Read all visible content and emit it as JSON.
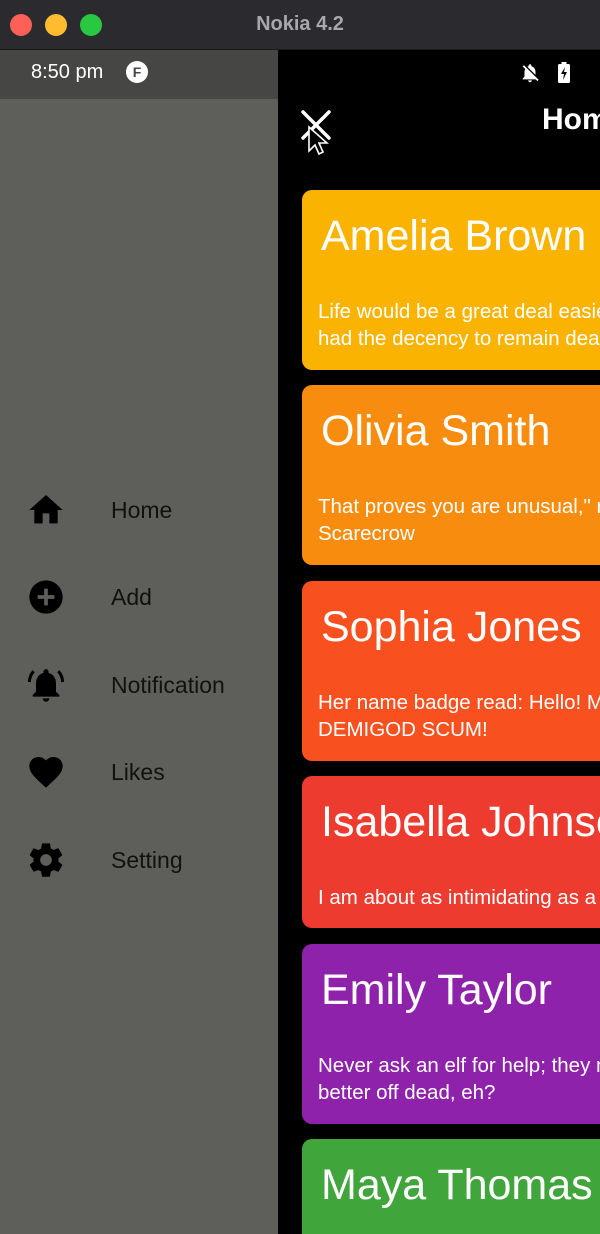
{
  "window": {
    "title": "Nokia 4.2"
  },
  "status_bar": {
    "time": "8:50 pm",
    "app_badge": "F"
  },
  "drawer": {
    "items": [
      {
        "label": "Home",
        "icon": "home-icon"
      },
      {
        "label": "Add",
        "icon": "add-circle-icon"
      },
      {
        "label": "Notification",
        "icon": "bell-ringing-icon"
      },
      {
        "label": "Likes",
        "icon": "heart-icon"
      },
      {
        "label": "Setting",
        "icon": "gear-icon"
      }
    ]
  },
  "header": {
    "title": "Home",
    "close_icon": "close-icon"
  },
  "cards": [
    {
      "name": "Amelia Brown",
      "line1": "Life would be a great deal easier if dead things",
      "line2": "had the decency to remain dead",
      "color": "#fbb302"
    },
    {
      "name": "Olivia Smith",
      "line1": "That proves you are unusual,\" returned the",
      "line2": "Scarecrow",
      "color": "#f88c0e"
    },
    {
      "name": "Sophia Jones",
      "line1": "Her name badge read: Hello! My name is",
      "line2": "DEMIGOD SCUM!",
      "color": "#f9501f"
    },
    {
      "name": "Isabella Johnson",
      "line1": "I am about as intimidating as a butterfly.",
      "line2": "",
      "color": "#ee3b2f"
    },
    {
      "name": "Emily Taylor",
      "line1": "Never ask an elf for help; they might decide you're",
      "line2": "better off dead, eh?",
      "color": "#8e22ab"
    },
    {
      "name": "Maya Thomas",
      "line1": "",
      "line2": "",
      "color": "#40a53b"
    }
  ]
}
